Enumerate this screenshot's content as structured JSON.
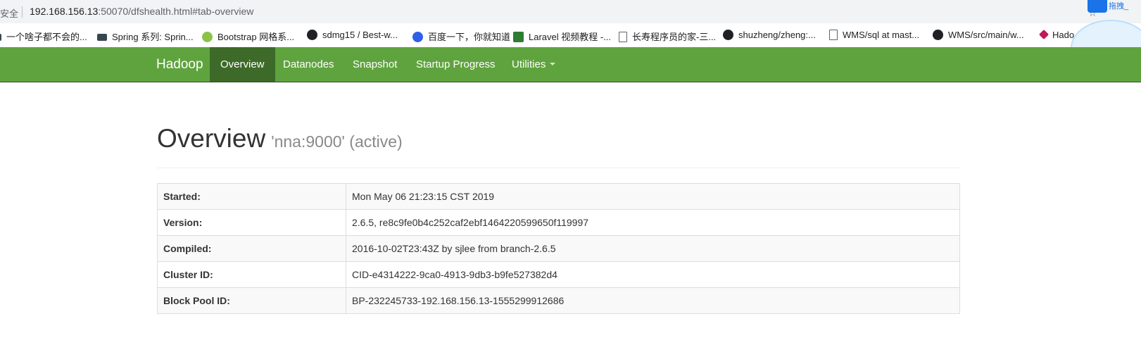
{
  "browser": {
    "security_label": "安全",
    "url_host": "192.168.156.13",
    "url_rest": ":50070/dfshealth.html#tab-overview",
    "extension_text": "拖拽_"
  },
  "bookmarks": [
    {
      "label": "一个啥子都不会的...",
      "icon": "page-icon"
    },
    {
      "label": "Spring 系列: Sprin...",
      "icon": "link-icon"
    },
    {
      "label": "Bootstrap 网格系...",
      "icon": "bootstrap-icon"
    },
    {
      "label": "sdmg15 / Best-w...",
      "icon": "github-icon"
    },
    {
      "label": "百度一下，你就知道",
      "icon": "baidu-icon"
    },
    {
      "label": "Laravel 视频教程 -...",
      "icon": "laravel-icon"
    },
    {
      "label": "长寿程序员的家-三...",
      "icon": "page-icon"
    },
    {
      "label": "shuzheng/zheng:...",
      "icon": "github-icon"
    },
    {
      "label": "WMS/sql at mast...",
      "icon": "page-icon"
    },
    {
      "label": "WMS/src/main/w...",
      "icon": "github-icon"
    },
    {
      "label": "Hado",
      "icon": "feather-icon"
    }
  ],
  "navbar": {
    "brand": "Hadoop",
    "items": [
      {
        "label": "Overview",
        "active": true
      },
      {
        "label": "Datanodes",
        "active": false
      },
      {
        "label": "Snapshot",
        "active": false
      },
      {
        "label": "Startup Progress",
        "active": false
      },
      {
        "label": "Utilities",
        "active": false,
        "dropdown": true
      }
    ],
    "colors": {
      "bar": "#5fa33e",
      "active": "#3d6a28"
    }
  },
  "page": {
    "title": "Overview",
    "subtitle": "'nna:9000' (active)"
  },
  "overview_table": [
    {
      "key": "Started:",
      "value": "Mon May 06 21:23:15 CST 2019"
    },
    {
      "key": "Version:",
      "value": "2.6.5, re8c9fe0b4c252caf2ebf1464220599650f119997"
    },
    {
      "key": "Compiled:",
      "value": "2016-10-02T23:43Z by sjlee from branch-2.6.5"
    },
    {
      "key": "Cluster ID:",
      "value": "CID-e4314222-9ca0-4913-9db3-b9fe527382d4"
    },
    {
      "key": "Block Pool ID:",
      "value": "BP-232245733-192.168.156.13-1555299912686"
    }
  ]
}
